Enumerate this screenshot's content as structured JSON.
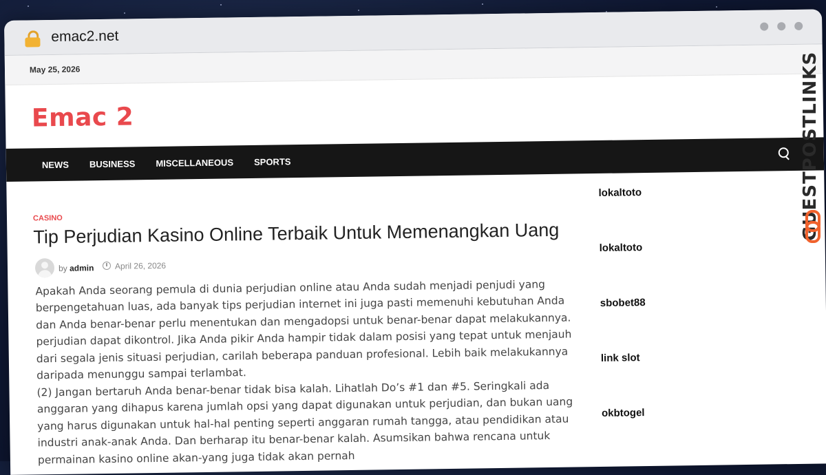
{
  "browser": {
    "url": "emac2.net"
  },
  "topbar": {
    "date": "May 25, 2026"
  },
  "site": {
    "title": "Emac 2"
  },
  "nav": {
    "items": [
      "NEWS",
      "BUSINESS",
      "MISCELLANEOUS",
      "SPORTS"
    ]
  },
  "post": {
    "category": "CASINO",
    "title": "Tip Perjudian Kasino Online Terbaik Untuk Memenangkan Uang",
    "by_label": "by",
    "author": "admin",
    "date": "April 26, 2026",
    "paragraphs": [
      "Apakah Anda seorang pemula di dunia perjudian online atau Anda sudah menjadi penjudi yang berpengetahuan luas, ada banyak tips perjudian internet ini juga pasti memenuhi kebutuhan Anda dan Anda benar-benar perlu menentukan dan mengadopsi untuk benar-benar dapat melakukannya.",
      "perjudian dapat dikontrol. Jika Anda pikir Anda hampir tidak dalam posisi yang tepat untuk menjauh dari segala jenis situasi perjudian, carilah beberapa panduan profesional. Lebih baik melakukannya daripada menunggu sampai terlambat.",
      "(2) Jangan bertaruh Anda benar-benar tidak bisa kalah. Lihatlah Do’s #1 dan #5. Seringkali ada anggaran yang dihapus karena jumlah opsi yang dapat digunakan untuk perjudian, dan bukan uang yang harus digunakan untuk hal-hal penting seperti anggaran rumah tangga, atau pendidikan atau industri anak-anak Anda. Dan berharap itu benar-benar kalah. Asumsikan bahwa rencana untuk permainan kasino online akan-yang juga tidak akan pernah"
    ]
  },
  "sidebar": {
    "links": [
      "lokaltoto",
      "lokaltoto",
      "sbobet88",
      "link slot",
      "okbtogel"
    ]
  },
  "watermark": {
    "text": "GUESTPOSTLINKS"
  }
}
